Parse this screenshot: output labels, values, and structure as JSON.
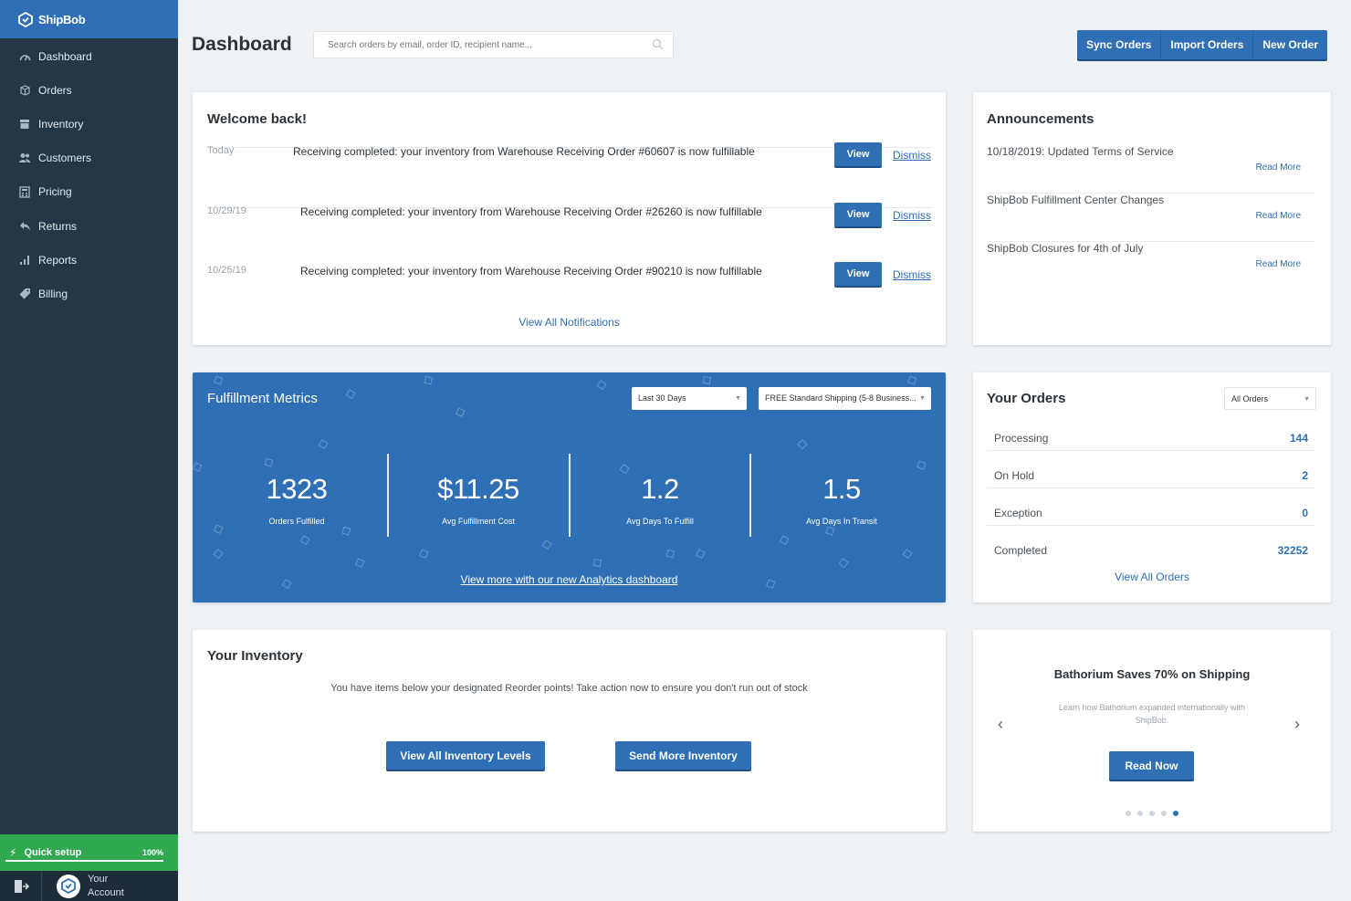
{
  "brand": {
    "name": "ShipBob"
  },
  "sidebar": {
    "items": [
      {
        "label": "Dashboard",
        "icon": "speedometer-icon"
      },
      {
        "label": "Orders",
        "icon": "box-icon"
      },
      {
        "label": "Inventory",
        "icon": "inventory-icon"
      },
      {
        "label": "Customers",
        "icon": "users-icon"
      },
      {
        "label": "Pricing",
        "icon": "calculator-icon"
      },
      {
        "label": "Returns",
        "icon": "return-arrow-icon"
      },
      {
        "label": "Reports",
        "icon": "bar-chart-icon"
      },
      {
        "label": "Billing",
        "icon": "tag-icon"
      }
    ],
    "quick_setup": {
      "label": "Quick setup",
      "percent_label": "100%",
      "progress": 1.0
    },
    "account": {
      "label": "Your Account"
    }
  },
  "header": {
    "title": "Dashboard",
    "search_placeholder": "Search orders by email, order ID, recipient name...",
    "actions": [
      "Sync Orders",
      "Import Orders",
      "New Order"
    ]
  },
  "welcome": {
    "title": "Welcome back!",
    "notifications": [
      {
        "date": "Today",
        "message": "Receiving completed: your inventory from Warehouse Receiving Order #60607 is now fulfillable",
        "view": "View",
        "dismiss": "Dismiss"
      },
      {
        "date": "10/29/19",
        "message": "Receiving completed: your inventory from Warehouse Receiving Order #26260 is now fulfillable",
        "view": "View",
        "dismiss": "Dismiss"
      },
      {
        "date": "10/25/19",
        "message": "Receiving completed: your inventory from Warehouse Receiving Order #90210 is now fulfillable",
        "view": "View",
        "dismiss": "Dismiss"
      }
    ],
    "view_all": "View All Notifications"
  },
  "announcements": {
    "title": "Announcements",
    "items": [
      {
        "text": "10/18/2019: Updated Terms of Service",
        "link": "Read More"
      },
      {
        "text": "ShipBob Fulfillment Center Changes",
        "link": "Read More"
      },
      {
        "text": "ShipBob Closures for 4th of July",
        "link": "Read More"
      }
    ]
  },
  "metrics": {
    "title": "Fulfillment Metrics",
    "period_select": "Last 30 Days",
    "shipping_select": "FREE Standard Shipping (5-8 Business...",
    "stats": [
      {
        "value": "1323",
        "label": "Orders Fulfilled"
      },
      {
        "value": "$11.25",
        "label": "Avg Fulfillment Cost"
      },
      {
        "value": "1.2",
        "label": "Avg Days To Fulfill"
      },
      {
        "value": "1.5",
        "label": "Avg Days In Transit"
      }
    ],
    "analytics_link": "View more with our new Analytics dashboard"
  },
  "orders": {
    "title": "Your Orders",
    "filter": "All Orders",
    "rows": [
      {
        "label": "Processing",
        "count": "144"
      },
      {
        "label": "On Hold",
        "count": "2"
      },
      {
        "label": "Exception",
        "count": "0"
      },
      {
        "label": "Completed",
        "count": "32252"
      }
    ],
    "view_all": "View All Orders"
  },
  "inventory": {
    "title": "Your Inventory",
    "note": "You have items below your designated Reorder points! Take action now to ensure you don't run out of stock",
    "btn_levels": "View All Inventory Levels",
    "btn_send": "Send More Inventory"
  },
  "promo": {
    "title": "Bathorium Saves 70% on Shipping",
    "subtitle": "Learn how Bathorium expanded internationally with ShipBob.",
    "button": "Read Now",
    "slide_count": 5,
    "active_slide": 5
  },
  "colors": {
    "primary": "#2f6fb5",
    "sidebar": "#243746",
    "success": "#2fa84f"
  }
}
